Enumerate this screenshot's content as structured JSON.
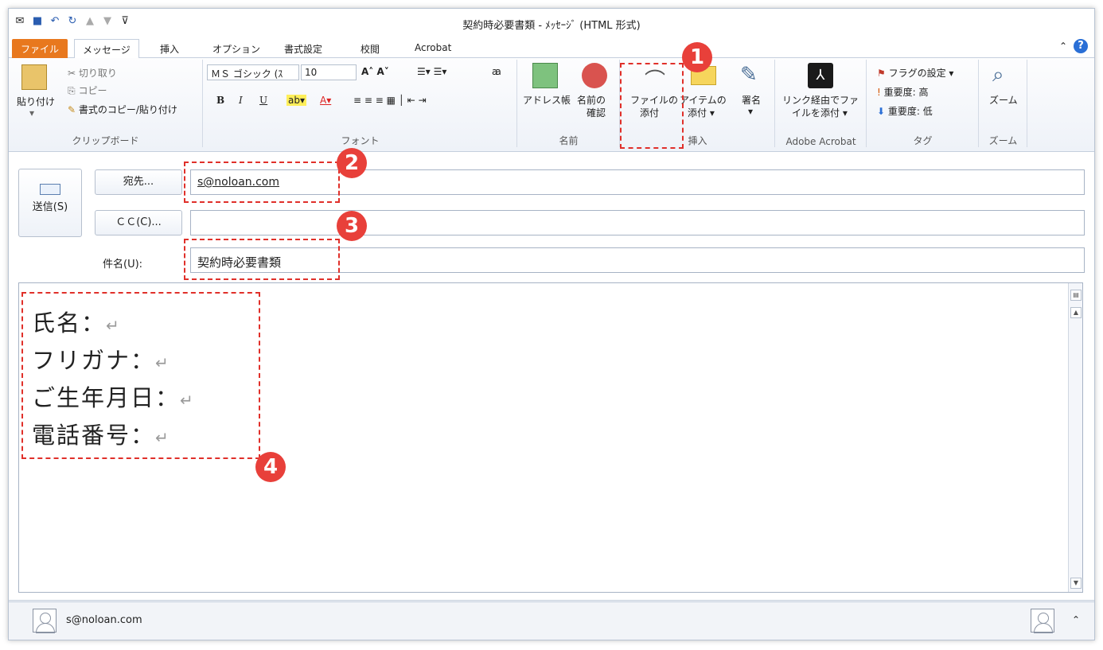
{
  "window": {
    "title": "契約時必要書類 - ﾒｯｾｰｼﾞ (HTML 形式)"
  },
  "tabs": [
    "ファイル",
    "メッセージ",
    "挿入",
    "オプション",
    "書式設定",
    "校閲",
    "Acrobat"
  ],
  "ribbon": {
    "clipboard": {
      "paste": "貼り付け",
      "cut": "切り取り",
      "copy": "コピー",
      "format_painter": "書式のコピー/貼り付け",
      "label": "クリップボード"
    },
    "font": {
      "family": "ＭＳ ゴシック (ｽ",
      "size": "10",
      "label": "フォント"
    },
    "names": {
      "address_book": "アドレス帳",
      "check_names_1": "名前の",
      "check_names_2": "確認",
      "label": "名前"
    },
    "insert": {
      "attach_file_1": "ファイルの",
      "attach_file_2": "添付",
      "attach_item_1": "アイテムの",
      "attach_item_2": "添付",
      "signature": "署名",
      "label": "挿入"
    },
    "acrobat": {
      "link_1": "リンク経由でファ",
      "link_2": "イルを添付",
      "label": "Adobe Acrobat"
    },
    "tags": {
      "flag": "フラグの設定",
      "high": "重要度: 高",
      "low": "重要度: 低",
      "label": "タグ"
    },
    "zoom": {
      "button": "ズーム",
      "label": "ズーム"
    }
  },
  "compose": {
    "send": "送信(S)",
    "to_button": "宛先...",
    "cc_button": "ＣＣ(C)...",
    "subject_label": "件名(U):",
    "to_value": "s@noloan.com",
    "cc_value": "",
    "subject_value": "契約時必要書類"
  },
  "body": {
    "lines": [
      "氏名：",
      "フリガナ：",
      "ご生年月日：",
      "電話番号："
    ]
  },
  "status": {
    "email": "s@noloan.com"
  },
  "annotations": [
    "1",
    "2",
    "3",
    "4"
  ],
  "colors": {
    "file_tab": "#e8781e",
    "annotation": "#e8403a",
    "dash": "#e0302a"
  }
}
